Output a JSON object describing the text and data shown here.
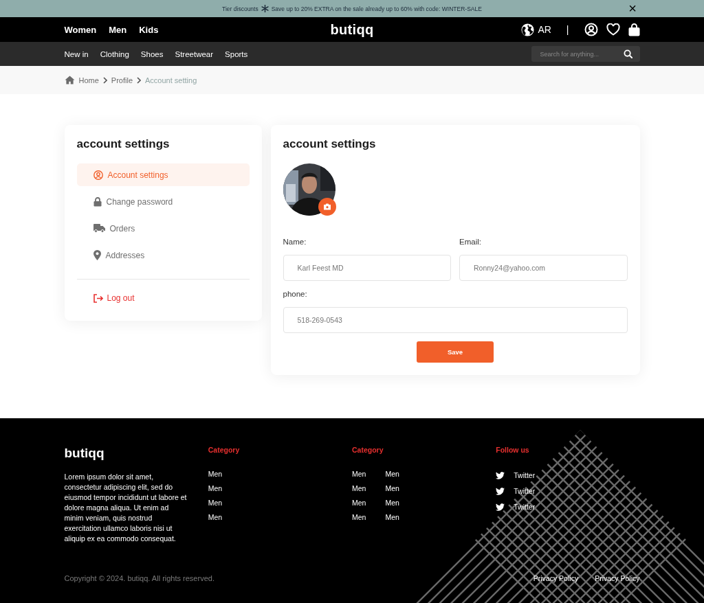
{
  "banner": {
    "prefix": "Tier discounts",
    "message": "Save up to 20% EXTRA on the sale already up to 60% with code: WINTER-SALE",
    "close": "×"
  },
  "header": {
    "nav": [
      "Women",
      "Men",
      "Kids"
    ],
    "logo": "butiqq",
    "language": "AR",
    "separator": "|"
  },
  "subnav": {
    "items": [
      "New in",
      "Clothing",
      "Shoes",
      "Streetwear",
      "Sports"
    ],
    "search": {
      "placeholder": "Search for anything..."
    }
  },
  "breadcrumb": [
    {
      "label": "Home",
      "current": false
    },
    {
      "label": "Profile",
      "current": false
    },
    {
      "label": "Account setting",
      "current": true
    }
  ],
  "sidebar": {
    "title": "account settings",
    "items": [
      {
        "label": "Account settings",
        "selected": true
      },
      {
        "label": "Change password",
        "selected": false
      },
      {
        "label": "Orders",
        "selected": false
      },
      {
        "label": "Addresses",
        "selected": false
      }
    ],
    "logout": "Log out"
  },
  "form": {
    "title": "account settings",
    "fields": [
      {
        "label": "Name:",
        "value": "Karl Feest MD"
      },
      {
        "label": "Email:",
        "value": "Ronny24@yahoo.com"
      },
      {
        "label": "phone:",
        "value": "518-269-0543"
      }
    ],
    "save": "Save"
  },
  "footer": {
    "logo": "butiqq",
    "description": "Lorem ipsum dolor sit amet, consectetur adipiscing elit, sed do eiusmod tempor incididunt ut labore et dolore magna aliqua. Ut enim ad minim veniam, quis nostrud exercitation ullamco laboris nisi ut aliquip ex ea commodo consequat.",
    "columns": [
      {
        "title": "Category",
        "links": [
          "Men",
          "Men",
          "Men",
          "Men"
        ]
      },
      {
        "title": "Category",
        "links": [
          "Men",
          "Men",
          "Men",
          "Men",
          "Men",
          "Men",
          "Men",
          "Men"
        ]
      }
    ],
    "social": {
      "title": "Follow us",
      "links": [
        "Twitter",
        "Twitter",
        "Twitter"
      ]
    },
    "copyright": "Copyright © 2024. butiqq. All rights reserved.",
    "legal": [
      "Privacy Policy",
      "Privacy Policy"
    ]
  }
}
